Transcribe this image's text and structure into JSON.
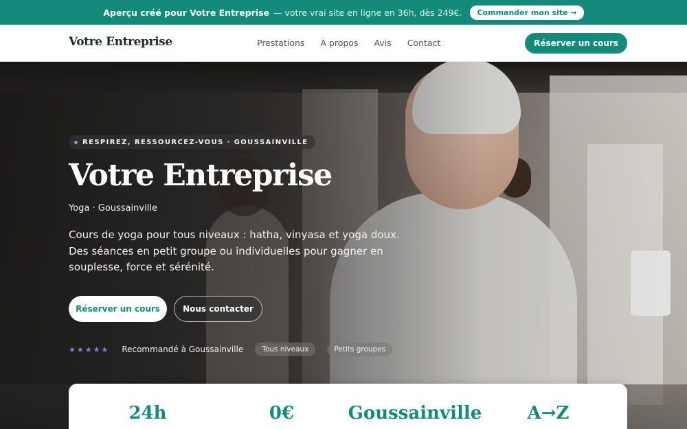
{
  "promo": {
    "strong_text": "Aperçu créé pour Votre Entreprise",
    "light_text": "— votre vrai site en ligne en 36h, dès 249€.",
    "cta_label": "Commander mon site →"
  },
  "header": {
    "logo": "Votre Entreprise",
    "nav": [
      "Prestations",
      "À propos",
      "Avis",
      "Contact"
    ],
    "cta_label": "Réserver un cours"
  },
  "hero": {
    "eyebrow": "RESPIREZ, RESSOURCEZ-VOUS · GOUSSAINVILLE",
    "title": "Votre Entreprise",
    "subtitle": "Yoga · Goussainville",
    "description": "Cours de yoga pour tous niveaux : hatha, vinyasa et yoga doux. Des séances en petit groupe ou individuelles pour gagner en souplesse, force et sérénité.",
    "primary_button": "Réserver un cours",
    "secondary_button": "Nous contacter",
    "stars": "★★★★★",
    "rating": 5,
    "recommendation": "Recommandé à Goussainville",
    "tags": [
      "Tous niveaux",
      "Petits groupes"
    ]
  },
  "stats": [
    "24h",
    "0€",
    "Goussainville",
    "A→Z"
  ],
  "colors": {
    "accent": "#138a7c",
    "star": "#8f84d9"
  }
}
